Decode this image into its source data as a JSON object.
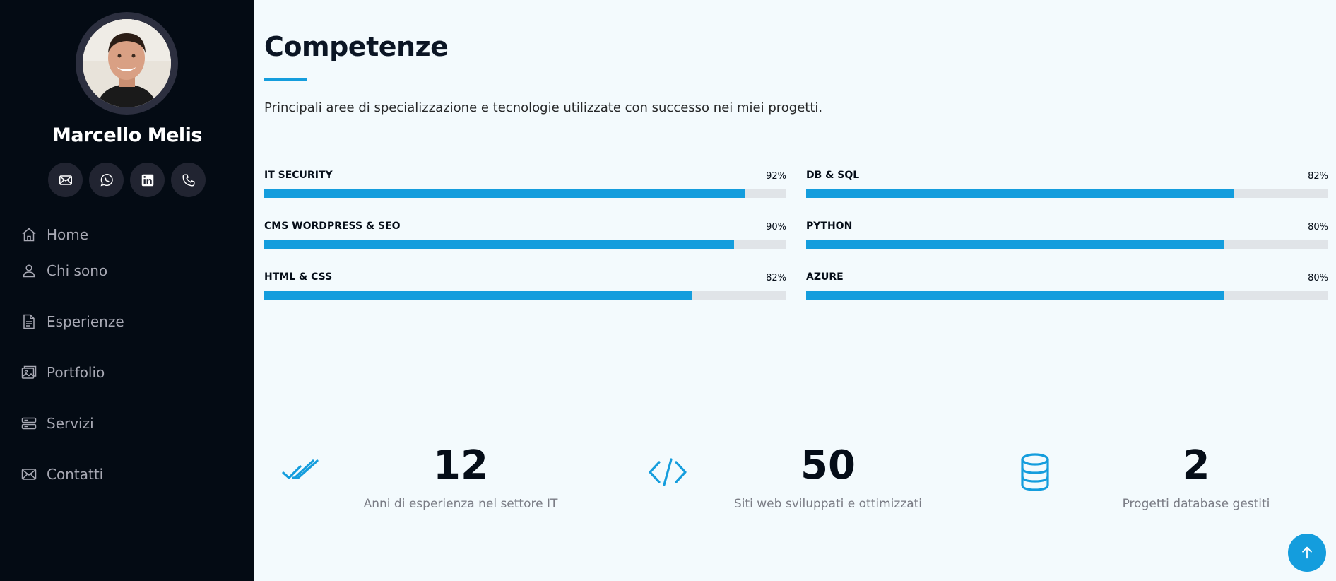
{
  "profile": {
    "name": "Marcello Melis"
  },
  "socials": [
    {
      "icon": "mail-icon"
    },
    {
      "icon": "whatsapp-icon"
    },
    {
      "icon": "linkedin-icon"
    },
    {
      "icon": "phone-icon"
    }
  ],
  "nav": {
    "items": [
      {
        "label": "Home",
        "icon": "home-icon"
      },
      {
        "label": "Chi sono",
        "icon": "person-icon"
      },
      {
        "label": "Esperienze",
        "icon": "document-icon"
      },
      {
        "label": "Portfolio",
        "icon": "images-icon"
      },
      {
        "label": "Servizi",
        "icon": "server-icon"
      },
      {
        "label": "Contatti",
        "icon": "envelope-icon"
      }
    ]
  },
  "section": {
    "title": "Competenze",
    "description": "Principali aree di specializzazione e tecnologie utilizzate con successo nei miei progetti."
  },
  "skills": [
    {
      "name": "IT SECURITY",
      "value": "92%",
      "percent": 92
    },
    {
      "name": "DB & SQL",
      "value": "82%",
      "percent": 82
    },
    {
      "name": "CMS WORDPRESS & SEO",
      "value": "90%",
      "percent": 90
    },
    {
      "name": "PYTHON",
      "value": "80%",
      "percent": 80
    },
    {
      "name": "HTML & CSS",
      "value": "82%",
      "percent": 82
    },
    {
      "name": "AZURE",
      "value": "80%",
      "percent": 80
    }
  ],
  "facts": [
    {
      "number": "12",
      "label": "Anni di esperienza nel settore IT",
      "icon": "check-all-icon"
    },
    {
      "number": "50",
      "label": "Siti web sviluppati e ottimizzati",
      "icon": "code-icon"
    },
    {
      "number": "2",
      "label": "Progetti database gestiti",
      "icon": "database-icon"
    }
  ],
  "colors": {
    "accent": "#149ddd",
    "sidebar_bg": "#040b14",
    "page_bg": "#f3fafd"
  }
}
